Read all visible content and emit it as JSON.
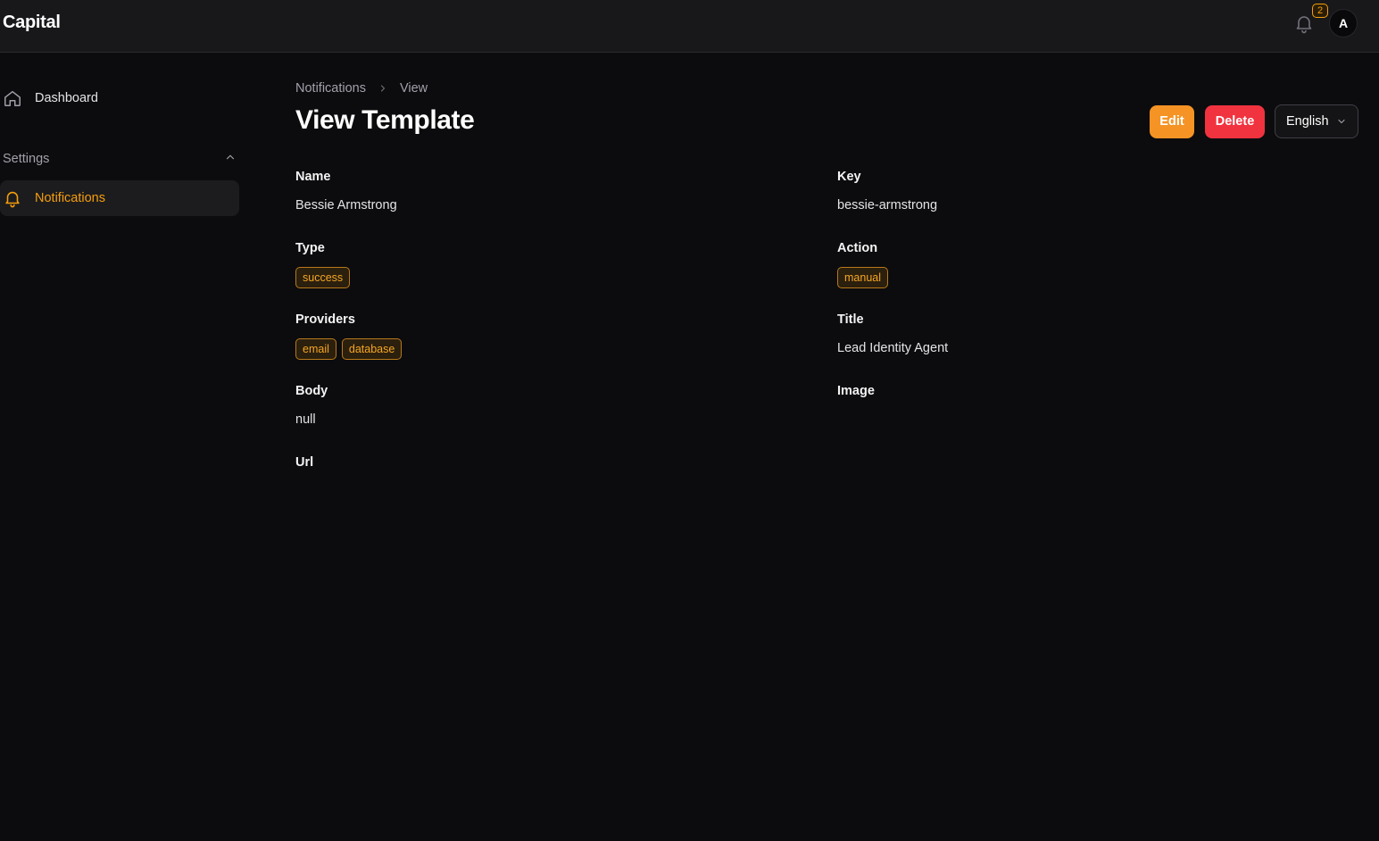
{
  "app": {
    "brand": "Capital"
  },
  "header": {
    "notification_count": "2",
    "avatar_initial": "A"
  },
  "sidebar": {
    "dashboard_label": "Dashboard",
    "group_label": "Settings",
    "notifications_label": "Notifications"
  },
  "breadcrumb": {
    "parent": "Notifications",
    "current": "View"
  },
  "page": {
    "title": "View Template",
    "edit_label": "Edit",
    "delete_label": "Delete",
    "language": "English"
  },
  "fields": {
    "name": {
      "label": "Name",
      "value": "Bessie Armstrong"
    },
    "key": {
      "label": "Key",
      "value": "bessie-armstrong"
    },
    "type": {
      "label": "Type",
      "badges": [
        "success"
      ]
    },
    "action": {
      "label": "Action",
      "badges": [
        "manual"
      ]
    },
    "providers": {
      "label": "Providers",
      "badges": [
        "email",
        "database"
      ]
    },
    "title": {
      "label": "Title",
      "value": "Lead Identity Agent"
    },
    "body": {
      "label": "Body",
      "value": "null"
    },
    "image": {
      "label": "Image",
      "value": ""
    },
    "url": {
      "label": "Url",
      "value": ""
    }
  },
  "colors": {
    "accent": "#f59e0b",
    "edit_button": "#f59425",
    "delete_button": "#f0333f",
    "background": "#0c0c0e",
    "topbar": "#18181b"
  },
  "icons": {
    "header_bell": "bell-icon",
    "dashboard": "home-icon",
    "notifications": "bell-icon",
    "group_toggle": "chevron-up-icon",
    "breadcrumb_sep": "chevron-right-icon",
    "language_dropdown": "chevron-down-icon"
  }
}
